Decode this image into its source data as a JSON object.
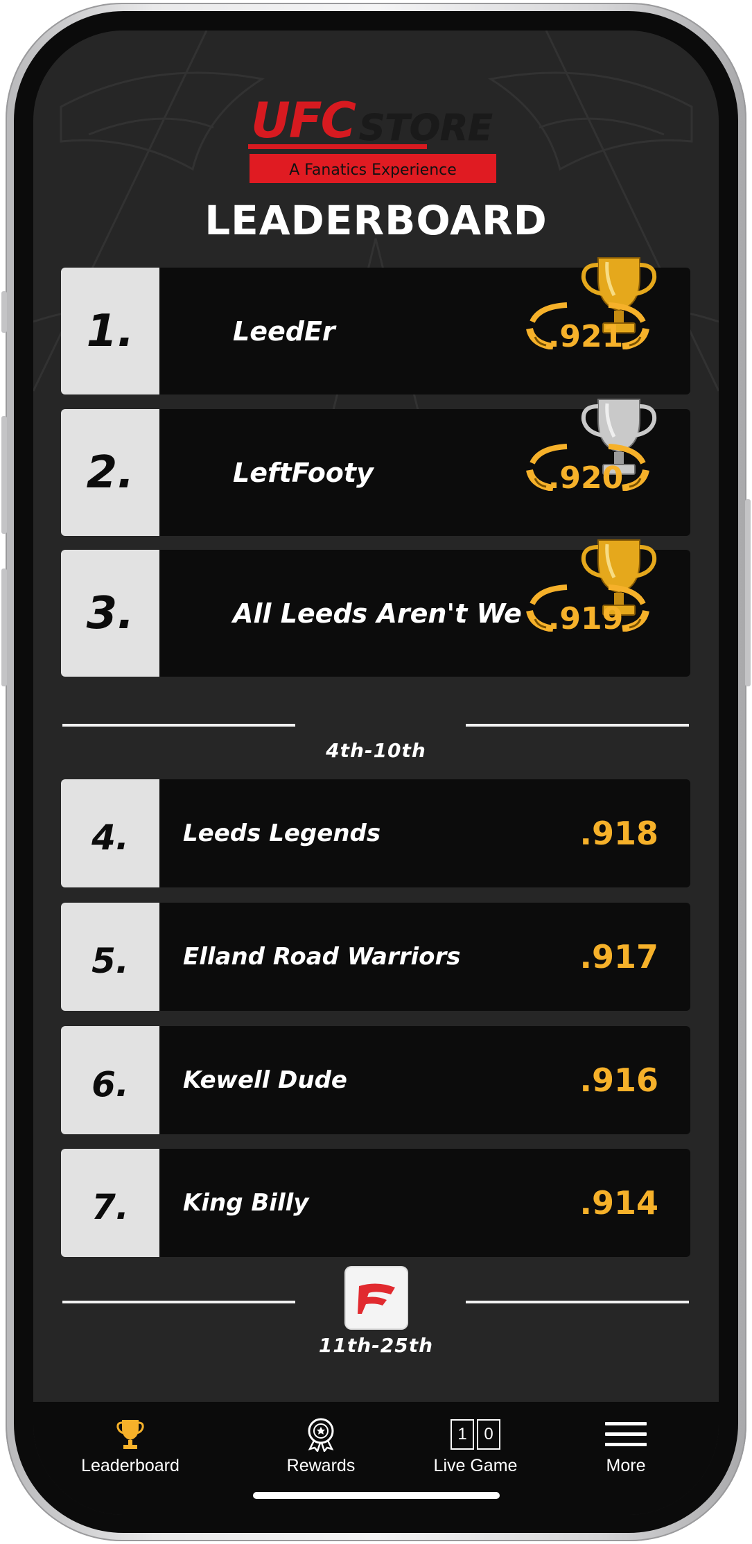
{
  "header": {
    "logo_brand": "UFC",
    "logo_store": "STORE",
    "logo_tagline": "A Fanatics Experience",
    "title": "LEADERBOARD"
  },
  "top_entries": [
    {
      "rank": "1.",
      "name": "LeedEr",
      "score": ".921",
      "trophy": "gold-trophy-icon"
    },
    {
      "rank": "2.",
      "name": "LeftFooty",
      "score": ".920",
      "trophy": "silver-trophy-icon"
    },
    {
      "rank": "3.",
      "name": "All Leeds Aren't We",
      "score": ".919",
      "trophy": "gold-trophy-icon"
    }
  ],
  "section_4_10": {
    "label": "4th-10th",
    "entries": [
      {
        "rank": "4.",
        "name": "Leeds Legends",
        "score": ".918"
      },
      {
        "rank": "5.",
        "name": "Elland Road Warriors",
        "score": ".917"
      },
      {
        "rank": "6.",
        "name": "Kewell Dude",
        "score": ".916"
      },
      {
        "rank": "7.",
        "name": "King Billy",
        "score": ".914"
      }
    ]
  },
  "section_11_25": {
    "label": "11th-25th",
    "badge_icon": "fanatics-logo-icon"
  },
  "tabbar": {
    "items": [
      {
        "label": "Leaderboard",
        "icon": "trophy-icon",
        "active": true
      },
      {
        "label": "Rewards",
        "icon": "rewards-medal-icon",
        "active": false
      },
      {
        "label": "Live Game",
        "icon": "scoreboard-icon",
        "score_left": "1",
        "score_right": "0",
        "active": false
      },
      {
        "label": "More",
        "icon": "menu-icon",
        "active": false
      }
    ]
  },
  "colors": {
    "accent_gold": "#f6b12a",
    "ufc_red": "#d71a20",
    "background": "#262626",
    "row_background": "#0c0c0c",
    "rank_background": "#e2e2e2"
  }
}
